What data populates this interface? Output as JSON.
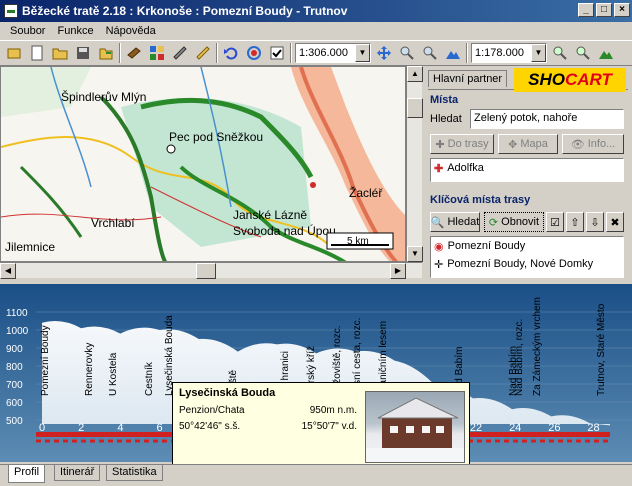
{
  "window": {
    "title": "Běžecké tratě 2.18 : Krkonoše : Pomezní Boudy - Trutnov",
    "minimize": "_",
    "maximize": "□",
    "close": "×"
  },
  "menu": [
    "Soubor",
    "Funkce",
    "Nápověda"
  ],
  "toolbar": {
    "map_scale": "1:306.000",
    "profile_scale": "1:178.000"
  },
  "map": {
    "places": [
      "Špindlerův Mlýn",
      "Pec pod Sněžkou",
      "Žacléř",
      "Vrchlabí",
      "Janské Lázně",
      "Svoboda nad Úpou",
      "Jilemnice"
    ],
    "scale_label": "5 km"
  },
  "panel": {
    "tab_label": "Hlavní partner",
    "logo": {
      "prefix": "SHO",
      "suffix": "CART"
    },
    "mista_header": "Místa",
    "search_label": "Hledat",
    "search_value": "Zelený potok, nahoře",
    "btn_do_trasy": "Do trasy",
    "btn_mapa": "Mapa",
    "btn_info": "Info...",
    "place_item": "Adolfka",
    "klicova_header": "Klíčová místa trasy",
    "btn_hledat": "Hledat",
    "btn_obnovit": "Obnovit",
    "route_items": [
      "Pomezní Boudy",
      "Pomezní Boudy, Nové Domky"
    ]
  },
  "profile": {
    "y_ticks": [
      "1100",
      "1000",
      "900",
      "800",
      "700",
      "600",
      "500"
    ],
    "x_ticks": [
      "0",
      "2",
      "4",
      "6",
      "8",
      "10",
      "12",
      "14",
      "16",
      "18",
      "20",
      "22",
      "24",
      "26",
      "28"
    ],
    "labels": [
      "Pomezní Boudy",
      "Rennerovky",
      "U Kostela",
      "Cestník",
      "Lysečinská Bouda",
      "Hřiště",
      "Na hranici",
      "Horský kříž",
      "Rýžoviště, rozc.",
      "Lesní cesta, rozc.",
      "Hraničním lesem",
      "Pod Babím",
      "Nad Babím",
      "Nad Babím, rozc.",
      "Za Zámeckým vrchem",
      "Trutnov, Staré Město"
    ],
    "elevation": [
      {
        "km": 0,
        "m": 1040
      },
      {
        "km": 2,
        "m": 1010
      },
      {
        "km": 4,
        "m": 980
      },
      {
        "km": 6,
        "m": 1000
      },
      {
        "km": 8,
        "m": 950
      },
      {
        "km": 10,
        "m": 880
      },
      {
        "km": 12,
        "m": 920
      },
      {
        "km": 14,
        "m": 870
      },
      {
        "km": 16,
        "m": 880
      },
      {
        "km": 18,
        "m": 830
      },
      {
        "km": 20,
        "m": 700
      },
      {
        "km": 22,
        "m": 620
      },
      {
        "km": 24,
        "m": 560
      },
      {
        "km": 26,
        "m": 520
      },
      {
        "km": 28,
        "m": 480
      }
    ]
  },
  "tooltip": {
    "name": "Lysečinská Bouda",
    "type": "Penzion/Chata",
    "elevation": "950m n.m.",
    "lat": "50°42'46\" s.š.",
    "lon": "15°50'7\" v.d."
  },
  "bottom_tabs": [
    "Profil",
    "Itinerář",
    "Statistika"
  ]
}
